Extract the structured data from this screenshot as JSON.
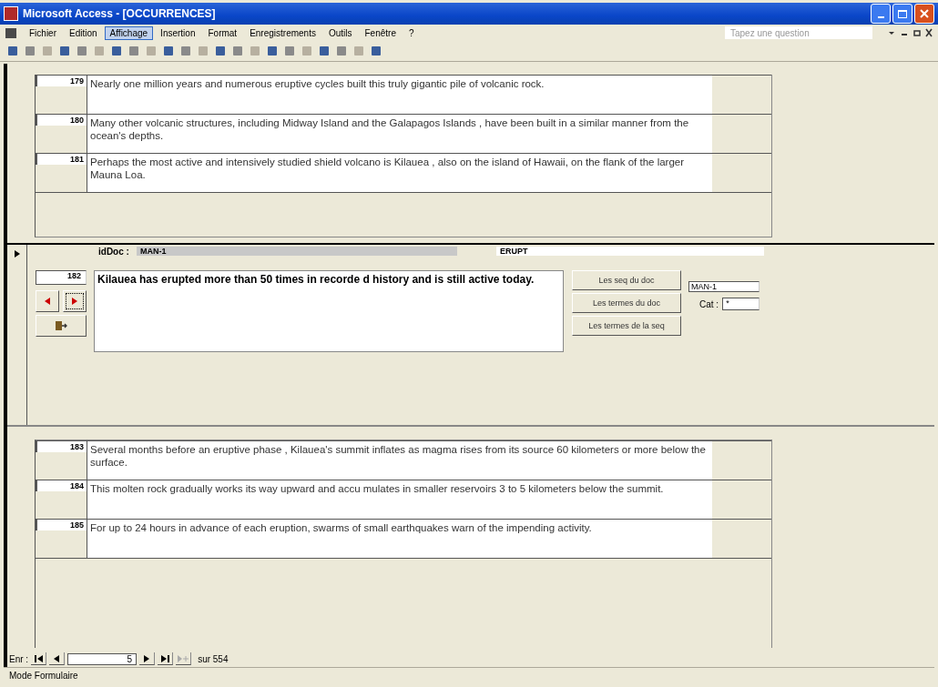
{
  "window": {
    "title": "Microsoft Access - [OCCURRENCES]"
  },
  "menu": [
    {
      "label": "Fichier",
      "selected": false
    },
    {
      "label": "Edition",
      "selected": false
    },
    {
      "label": "Affichage",
      "selected": true
    },
    {
      "label": "Insertion",
      "selected": false
    },
    {
      "label": "Format",
      "selected": false
    },
    {
      "label": "Enregistrements",
      "selected": false
    },
    {
      "label": "Outils",
      "selected": false
    },
    {
      "label": "Fenêtre",
      "selected": false
    },
    {
      "label": "?",
      "selected": false
    }
  ],
  "help_search": {
    "placeholder": "Tapez une question"
  },
  "upper_subform": {
    "rows": [
      {
        "number": "179",
        "text": "Nearly one million years and numerous eruptive cycles built this truly gigantic pile of volcanic rock."
      },
      {
        "number": "180",
        "text": "Many other volcanic structures, including Midway Island and the Galapagos Islands , have been built in a similar manner from the ocean's depths."
      },
      {
        "number": "181",
        "text": "Perhaps the most active and intensively studied shield volcano is Kilauea , also on the island of Hawaii, on the flank of the larger Mauna Loa."
      }
    ]
  },
  "record": {
    "id_label": "idDoc :",
    "id_value": "MAN-1",
    "category": "ERUPT",
    "number": "182",
    "text": "Kilauea has erupted more than 50 times in recorde d history and is still active today.",
    "buttons": [
      "Les seq du doc",
      "Les termes du doc",
      "Les termes de la seq"
    ],
    "doc_field": "MAN-1",
    "cat_label": "Cat :",
    "cat_value": "*"
  },
  "lower_subform": {
    "rows": [
      {
        "number": "183",
        "text": "Several months before an eruptive phase , Kilauea's summit inflates as magma rises from its source 60 kilometers or more below the surface."
      },
      {
        "number": "184",
        "text": "This molten rock gradually works its way upward and accu mulates in smaller reservoirs 3 to 5 kilometers below the summit."
      },
      {
        "number": "185",
        "text": "For up to 24 hours in advance of each eruption, swarms of small earthquakes warn of the impending activity."
      }
    ]
  },
  "navigation": {
    "label": "Enr :",
    "current": "5",
    "total": "sur 554"
  },
  "status_bar": "Mode Formulaire"
}
